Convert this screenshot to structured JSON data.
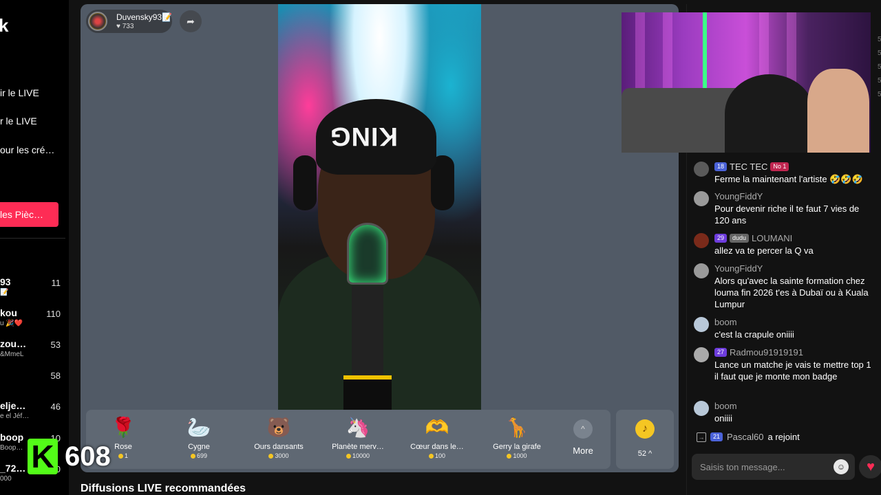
{
  "sidebar": {
    "logo": "k",
    "links": [
      "ir le LIVE",
      "r le LIVE",
      "our les cré…"
    ],
    "coins_button": "les Pièc…",
    "viewers": [
      {
        "name": "93",
        "sub": "📝",
        "count": "11"
      },
      {
        "name": "kou",
        "sub": "u 🎉❤️",
        "count": "110"
      },
      {
        "name": "zou…",
        "sub": "&MmeL",
        "count": "53"
      },
      {
        "name": "",
        "sub": "",
        "count": "58"
      },
      {
        "name": "elje…",
        "sub": "e el Jéf…",
        "count": "46"
      },
      {
        "name": "boop",
        "sub": "Boop…",
        "count": "10"
      },
      {
        "name": "_72…",
        "sub": "000",
        "count": "30"
      }
    ]
  },
  "overlay": {
    "badge": "K",
    "count": "608"
  },
  "host": {
    "name": "Duvensky93📝",
    "likes": "♥ 733"
  },
  "icons": {
    "share": "share-icon",
    "heart": "heart-icon",
    "emoji": "emoji-icon",
    "join": "join-icon"
  },
  "video": {
    "beanie_text": "KING"
  },
  "gifts": [
    {
      "icon": "🌹",
      "name": "Rose",
      "price": "1"
    },
    {
      "icon": "🦢",
      "name": "Cygne",
      "price": "699"
    },
    {
      "icon": "🐻",
      "name": "Ours dansants",
      "price": "3000"
    },
    {
      "icon": "🦄",
      "name": "Planète merv…",
      "price": "10000"
    },
    {
      "icon": "🫶",
      "name": "Cœur dans le…",
      "price": "100"
    },
    {
      "icon": "🦒",
      "name": "Gerry la girafe",
      "price": "1000"
    }
  ],
  "more": {
    "label": "More",
    "arrow": "^"
  },
  "coins": {
    "icon": "♪",
    "count": "52 ^"
  },
  "recommended": "Diffusions LIVE recommandées",
  "chat": {
    "messages": [
      {
        "level": "18",
        "user": "TEC TEC",
        "extra": "No 1",
        "text": "Ferme la maintenant l'artiste 🤣🤣🤣"
      },
      {
        "level": "",
        "user": "YoungFiddY",
        "extra": "",
        "text": "Pour devenir riche il te faut 7 vies de 120 ans"
      },
      {
        "level": "29",
        "user": "LOUMANI",
        "extra": "dudu",
        "text": "allez va te percer la Q va"
      },
      {
        "level": "",
        "user": "YoungFiddY",
        "extra": "",
        "text": "Alors qu'avec la sainte formation chez louma fin 2026 t'es à Dubaï ou à Kuala Lumpur"
      },
      {
        "level": "",
        "user": "boom",
        "extra": "",
        "text": "c'est la crapule oniiii"
      },
      {
        "level": "27",
        "user": "Radmou91919191",
        "extra": "",
        "text": "Lance un matche je vais te mettre top 1 il faut que je monte mon badge"
      },
      {
        "level": "",
        "user": "boom",
        "extra": "",
        "text": "oniiii"
      }
    ],
    "join": {
      "level": "21",
      "user": "Pascal60",
      "text": "a rejoint"
    },
    "input_placeholder": "Saisis ton message...",
    "edge_numbers": [
      "5",
      "5",
      "5",
      "5",
      "5"
    ]
  },
  "colors": {
    "accent": "#fe2c55",
    "kick_green": "#53fc18",
    "gift_bar": "#5f6873",
    "stage": "#515a66"
  }
}
